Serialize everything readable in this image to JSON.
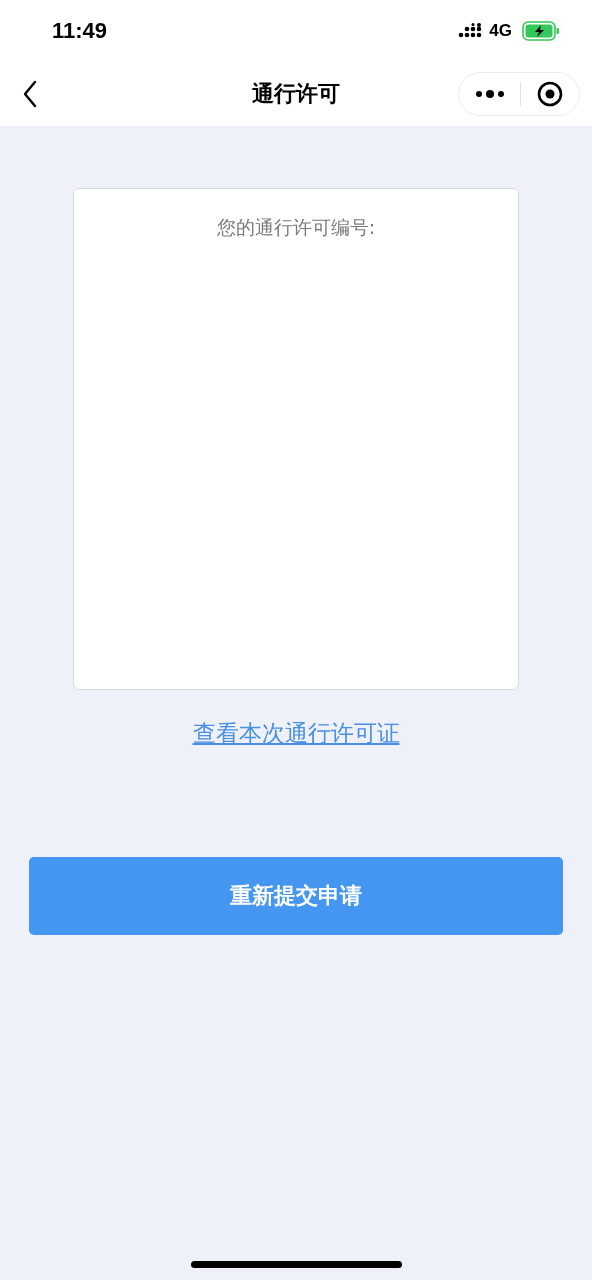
{
  "status_bar": {
    "time": "11:49",
    "network": "4G"
  },
  "nav": {
    "title": "通行许可"
  },
  "card": {
    "label": "您的通行许可编号:"
  },
  "link": "查看本次通行许可证",
  "button": "重新提交申请"
}
